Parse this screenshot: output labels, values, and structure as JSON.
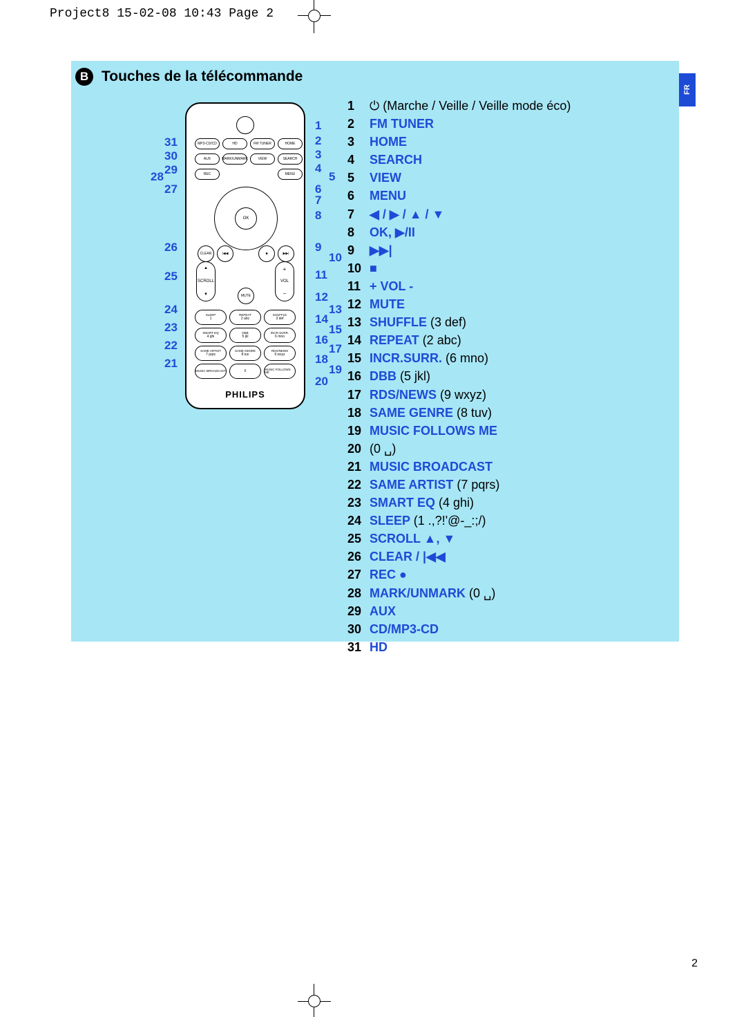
{
  "crop_header": "Project8  15-02-08  10:43  Page 2",
  "lang_tab": "FR",
  "section_letter": "B",
  "section_title": "Touches de la télécommande",
  "brand": "PHILIPS",
  "page_number": "2",
  "remote_labels": {
    "rowA": [
      "MP3-CD/CD",
      "HD",
      "FM TUNER",
      "HOME"
    ],
    "rowB": [
      "AUX",
      "MARK/UNMARK",
      "VIEW",
      "SEARCH"
    ],
    "rowC": [
      "REC",
      "",
      "",
      "MENU"
    ],
    "ok": "OK",
    "scroll": "SCROLL",
    "vol": "VOL",
    "clear": "CLEAR",
    "mute": "MUTE",
    "grid": [
      [
        "SLEEP",
        "1"
      ],
      [
        "REPEAT",
        "2 abc"
      ],
      [
        "SHUFFLE",
        "3 def"
      ],
      [
        "SMART EQ",
        "4 ghi"
      ],
      [
        "DBB",
        "5 jkl"
      ],
      [
        "INCR.SURR.",
        "6 mno"
      ],
      [
        "SAME ARTIST",
        "7 pqrs"
      ],
      [
        "SAME GENRE",
        "8 tuv"
      ],
      [
        "RDS/NEWS",
        "9 wxyz"
      ],
      [
        "MUSIC BROADCAST",
        "0"
      ],
      [
        "",
        "0"
      ],
      [
        "MUSIC FOLLOWS ME",
        ""
      ]
    ]
  },
  "callouts_right": [
    "1",
    "2",
    "3",
    "4",
    "5",
    "6",
    "7",
    "8",
    "9",
    "10",
    "11",
    "12",
    "13",
    "14",
    "15",
    "16",
    "17",
    "18",
    "19",
    "20"
  ],
  "callouts_left": [
    "31",
    "30",
    "29",
    "28",
    "27",
    "26",
    "25",
    "24",
    "23",
    "22",
    "21"
  ],
  "legend": [
    {
      "n": "1",
      "blue": "",
      "plain": "⏻ (Marche / Veille / Veille mode éco)"
    },
    {
      "n": "2",
      "blue": "FM TUNER",
      "plain": ""
    },
    {
      "n": "3",
      "blue": "HOME",
      "plain": ""
    },
    {
      "n": "4",
      "blue": "SEARCH",
      "plain": ""
    },
    {
      "n": "5",
      "blue": "VIEW",
      "plain": ""
    },
    {
      "n": "6",
      "blue": "MENU",
      "plain": ""
    },
    {
      "n": "7",
      "blue": "◀ / ▶ / ▲ / ▼",
      "plain": ""
    },
    {
      "n": "8",
      "blue": "OK, ▶/II",
      "plain": ""
    },
    {
      "n": "9",
      "blue": "▶▶|",
      "plain": ""
    },
    {
      "n": "10",
      "blue": "■",
      "plain": ""
    },
    {
      "n": "11",
      "blue": "+ VOL -",
      "plain": ""
    },
    {
      "n": "12",
      "blue": "MUTE",
      "plain": ""
    },
    {
      "n": "13",
      "blue": "SHUFFLE ",
      "plain": "(3 def)"
    },
    {
      "n": "14",
      "blue": "REPEAT ",
      "plain": "(2 abc)"
    },
    {
      "n": "15",
      "blue": "INCR.SURR. ",
      "plain": "(6 mno)"
    },
    {
      "n": "16",
      "blue": "DBB ",
      "plain": "(5 jkl)"
    },
    {
      "n": "17",
      "blue": "RDS/NEWS ",
      "plain": "(9 wxyz)"
    },
    {
      "n": "18",
      "blue": "SAME GENRE ",
      "plain": "(8 tuv)"
    },
    {
      "n": "19",
      "blue": "MUSIC FOLLOWS ME",
      "plain": ""
    },
    {
      "n": "20",
      "blue": "",
      "plain": "(0 ␣)"
    },
    {
      "n": "21",
      "blue": "MUSIC BROADCAST",
      "plain": ""
    },
    {
      "n": "22",
      "blue": "SAME ARTIST ",
      "plain": "(7 pqrs)"
    },
    {
      "n": "23",
      "blue": "SMART EQ ",
      "plain": "(4 ghi)"
    },
    {
      "n": "24",
      "blue": "SLEEP ",
      "plain": "(1 .,?!'@-_:;/)"
    },
    {
      "n": "25",
      "blue": "SCROLL ▲, ▼",
      "plain": ""
    },
    {
      "n": "26",
      "blue": "CLEAR / |◀◀",
      "plain": ""
    },
    {
      "n": "27",
      "blue": "REC ●",
      "plain": ""
    },
    {
      "n": "28",
      "blue": "MARK/UNMARK ",
      "plain": "(0 ␣)"
    },
    {
      "n": "29",
      "blue": "AUX",
      "plain": ""
    },
    {
      "n": "30",
      "blue": "CD/MP3-CD",
      "plain": ""
    },
    {
      "n": "31",
      "blue": "HD",
      "plain": ""
    }
  ]
}
